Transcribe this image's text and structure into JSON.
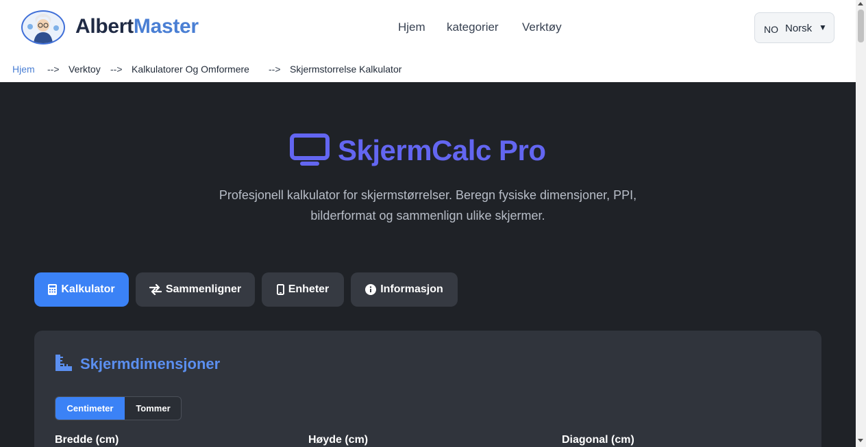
{
  "brand": {
    "part1": "Albert",
    "part2": "Master"
  },
  "nav": [
    {
      "label": "Hjem"
    },
    {
      "label": "kategorier"
    },
    {
      "label": "Verktøy"
    }
  ],
  "language": {
    "code": "NO",
    "name": "Norsk"
  },
  "breadcrumb": {
    "home": "Hjem",
    "separator": "-->",
    "items": [
      "Verktoy",
      "Kalkulatorer Og Omformere",
      "Skjermstorrelse Kalkulator"
    ]
  },
  "hero": {
    "icon": "monitor-icon",
    "title": "SkjermCalc Pro",
    "description": "Profesjonell kalkulator for skjermstørrelser. Beregn fysiske dimensjoner, PPI, bilderformat og sammenlign ulike skjermer."
  },
  "tabs": [
    {
      "label": "Kalkulator",
      "icon": "calculator-icon",
      "active": true
    },
    {
      "label": "Sammenligner",
      "icon": "exchange-icon",
      "active": false
    },
    {
      "label": "Enheter",
      "icon": "mobile-icon",
      "active": false
    },
    {
      "label": "Informasjon",
      "icon": "info-icon",
      "active": false
    }
  ],
  "card": {
    "icon": "ruler-icon",
    "title": "Skjermdimensjoner",
    "units": [
      {
        "label": "Centimeter",
        "active": true
      },
      {
        "label": "Tommer",
        "active": false
      }
    ],
    "fields": [
      {
        "label": "Bredde (cm)"
      },
      {
        "label": "Høyde (cm)"
      },
      {
        "label": "Diagonal (cm)"
      }
    ]
  },
  "colors": {
    "accent": "#3b82f6",
    "title": "#6366f1",
    "background": "#1f2227",
    "card": "#30343c",
    "tab": "#363a42"
  }
}
